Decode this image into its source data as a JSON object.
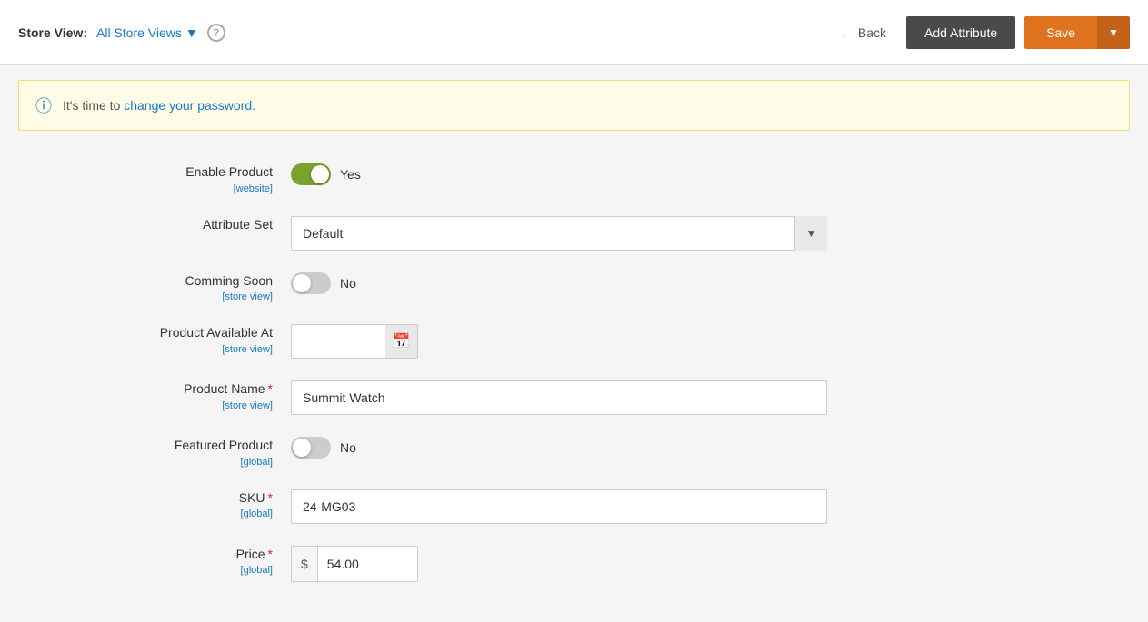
{
  "header": {
    "store_view_label": "Store View:",
    "store_view_value": "All Store Views",
    "back_label": "Back",
    "add_attribute_label": "Add Attribute",
    "save_label": "Save"
  },
  "notice": {
    "text_before": "It's time to",
    "link_text": "change your password.",
    "text_after": ""
  },
  "form": {
    "enable_product": {
      "label": "Enable Product",
      "sub_label": "[website]",
      "toggle_state": "on",
      "toggle_text": "Yes"
    },
    "attribute_set": {
      "label": "Attribute Set",
      "value": "Default"
    },
    "comming_soon": {
      "label": "Comming Soon",
      "sub_label": "[store view]",
      "toggle_state": "off",
      "toggle_text": "No"
    },
    "product_available_at": {
      "label": "Product Available At",
      "sub_label": "[store view]",
      "value": ""
    },
    "product_name": {
      "label": "Product Name",
      "sub_label": "[store view]",
      "value": "Summit Watch",
      "required": true
    },
    "featured_product": {
      "label": "Featured Product",
      "sub_label": "[global]",
      "toggle_state": "off",
      "toggle_text": "No"
    },
    "sku": {
      "label": "SKU",
      "sub_label": "[global]",
      "value": "24-MG03",
      "required": true
    },
    "price": {
      "label": "Price",
      "sub_label": "[global]",
      "currency": "$",
      "value": "54.00",
      "required": true
    }
  }
}
